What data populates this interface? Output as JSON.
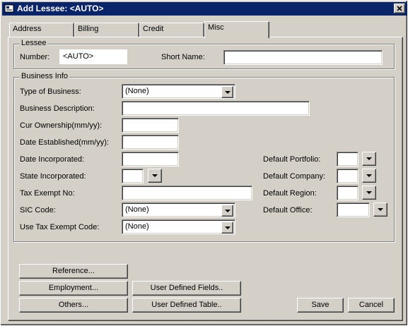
{
  "window": {
    "title": "Add Lessee: <AUTO>"
  },
  "tabs": [
    {
      "label": "Address"
    },
    {
      "label": "Billing"
    },
    {
      "label": "Credit"
    },
    {
      "label": "Misc"
    }
  ],
  "lessee": {
    "group_title": "Lessee",
    "number_label": "Number:",
    "number_value": "<AUTO>",
    "short_name_label": "Short Name:",
    "short_name_value": ""
  },
  "business": {
    "group_title": "Business Info",
    "type_label": "Type of Business:",
    "type_value": "(None)",
    "description_label": "Business Description:",
    "description_value": "",
    "ownership_label": "Cur Ownership(mm/yy):",
    "ownership_value": "",
    "established_label": "Date Established(mm/yy):",
    "established_value": "",
    "incorporated_label": "Date Incorporated:",
    "incorporated_value": "",
    "state_label": "State Incorporated:",
    "state_value": "",
    "tax_exempt_label": "Tax Exempt No:",
    "tax_exempt_value": "",
    "sic_label": "SIC Code:",
    "sic_value": "(None)",
    "use_tax_label": "Use Tax Exempt Code:",
    "use_tax_value": "(None)",
    "portfolio_label": "Default Portfolio:",
    "company_label": "Default Company:",
    "region_label": "Default Region:",
    "office_label": "Default Office:"
  },
  "buttons": {
    "reference": "Reference...",
    "employment": "Employment...",
    "others": "Others...",
    "user_fields": "User Defined Fields..",
    "user_table": "User Defined Table..",
    "save": "Save",
    "cancel": "Cancel"
  }
}
